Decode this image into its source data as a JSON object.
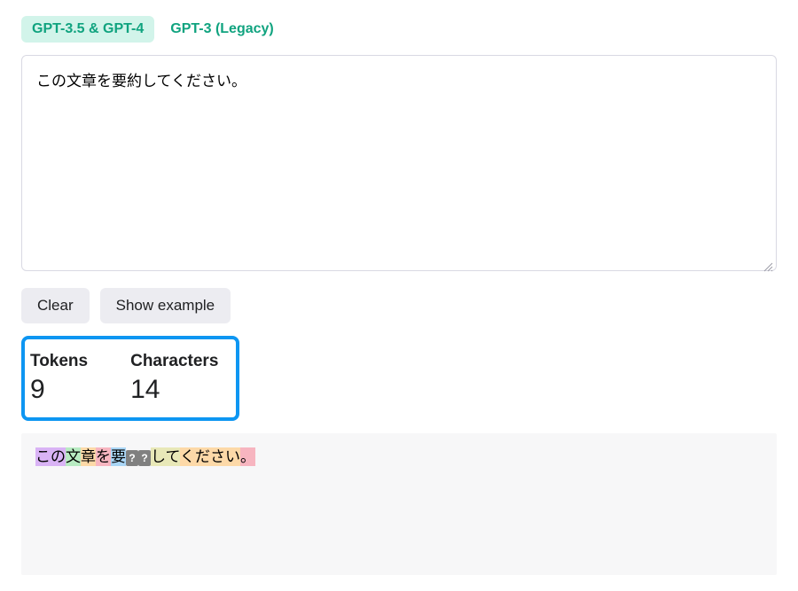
{
  "tabs": {
    "active": "GPT-3.5 & GPT-4",
    "inactive": "GPT-3 (Legacy)"
  },
  "input": {
    "value": "この文章を要約してください。"
  },
  "buttons": {
    "clear": "Clear",
    "show_example": "Show example"
  },
  "stats": {
    "tokens_label": "Tokens",
    "tokens_value": "9",
    "characters_label": "Characters",
    "characters_value": "14"
  },
  "tokens": [
    {
      "text": "この",
      "color": "c0"
    },
    {
      "text": "文",
      "color": "c1"
    },
    {
      "text": "章",
      "color": "c2"
    },
    {
      "text": "を",
      "color": "c3"
    },
    {
      "text": "要",
      "color": "c4"
    },
    {
      "text": "??",
      "color": "unk"
    },
    {
      "text": "して",
      "color": "c5"
    },
    {
      "text": "ください",
      "color": "c2"
    },
    {
      "text": "。",
      "color": "c3"
    }
  ]
}
